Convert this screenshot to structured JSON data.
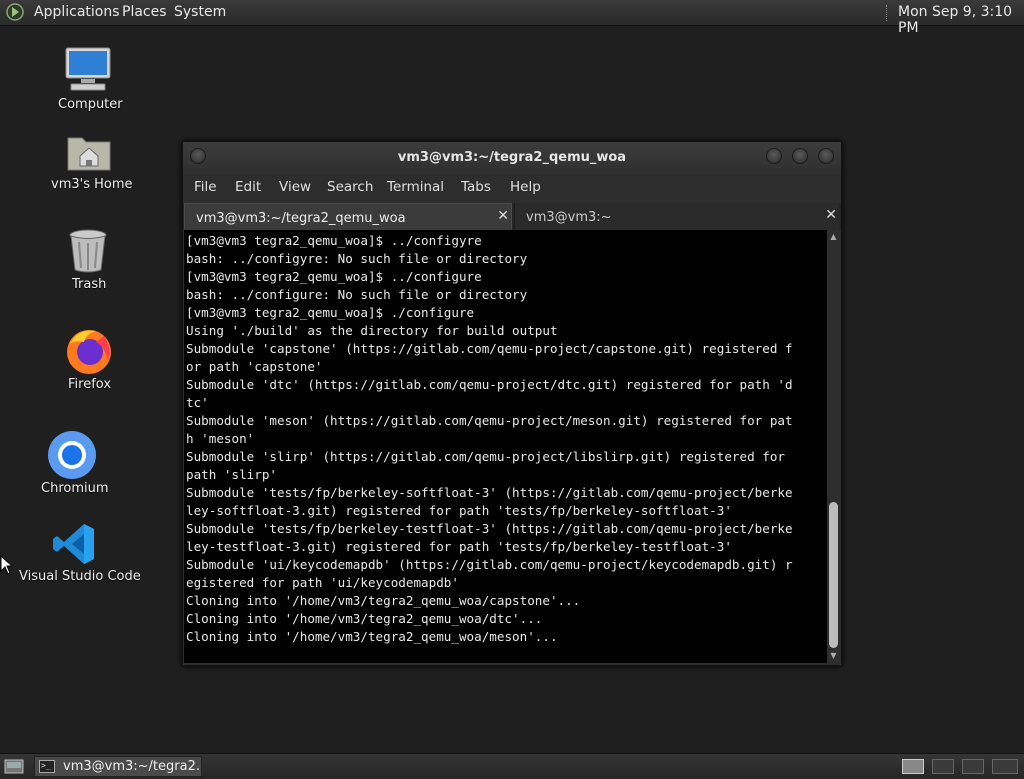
{
  "top_panel": {
    "menus": [
      "Applications",
      "Places",
      "System"
    ],
    "clock": "Mon Sep  9,  3:10 PM"
  },
  "desktop_icons": [
    {
      "label": "Computer",
      "icon": "computer-icon"
    },
    {
      "label": "vm3's Home",
      "icon": "home-folder-icon"
    },
    {
      "label": "Trash",
      "icon": "trash-icon"
    },
    {
      "label": "Firefox",
      "icon": "firefox-icon"
    },
    {
      "label": "Chromium",
      "icon": "chromium-icon"
    },
    {
      "label": "Visual Studio Code",
      "icon": "vscode-icon"
    }
  ],
  "terminal": {
    "title": "vm3@vm3:~/tegra2_qemu_woa",
    "menu": [
      "File",
      "Edit",
      "View",
      "Search",
      "Terminal",
      "Tabs",
      "Help"
    ],
    "tabs": [
      {
        "label": "vm3@vm3:~/tegra2_qemu_woa",
        "active": true
      },
      {
        "label": "vm3@vm3:~",
        "active": false
      }
    ],
    "output": "[vm3@vm3 tegra2_qemu_woa]$ ../configyre\nbash: ../configyre: No such file or directory\n[vm3@vm3 tegra2_qemu_woa]$ ../configure\nbash: ../configure: No such file or directory\n[vm3@vm3 tegra2_qemu_woa]$ ./configure\nUsing './build' as the directory for build output\nSubmodule 'capstone' (https://gitlab.com/qemu-project/capstone.git) registered f\nor path 'capstone'\nSubmodule 'dtc' (https://gitlab.com/qemu-project/dtc.git) registered for path 'd\ntc'\nSubmodule 'meson' (https://gitlab.com/qemu-project/meson.git) registered for pat\nh 'meson'\nSubmodule 'slirp' (https://gitlab.com/qemu-project/libslirp.git) registered for\npath 'slirp'\nSubmodule 'tests/fp/berkeley-softfloat-3' (https://gitlab.com/qemu-project/berke\nley-softfloat-3.git) registered for path 'tests/fp/berkeley-softfloat-3'\nSubmodule 'tests/fp/berkeley-testfloat-3' (https://gitlab.com/qemu-project/berke\nley-testfloat-3.git) registered for path 'tests/fp/berkeley-testfloat-3'\nSubmodule 'ui/keycodemapdb' (https://gitlab.com/qemu-project/keycodemapdb.git) r\negistered for path 'ui/keycodemapdb'\nCloning into '/home/vm3/tegra2_qemu_woa/capstone'...\nCloning into '/home/vm3/tegra2_qemu_woa/dtc'...\nCloning into '/home/vm3/tegra2_qemu_woa/meson'..."
  },
  "taskbar": {
    "window_button": "vm3@vm3:~/tegra2..."
  },
  "colors": {
    "desktop": "#1f1f1f",
    "terminal_bg": "#000000",
    "terminal_fg": "#e8e8e8"
  }
}
